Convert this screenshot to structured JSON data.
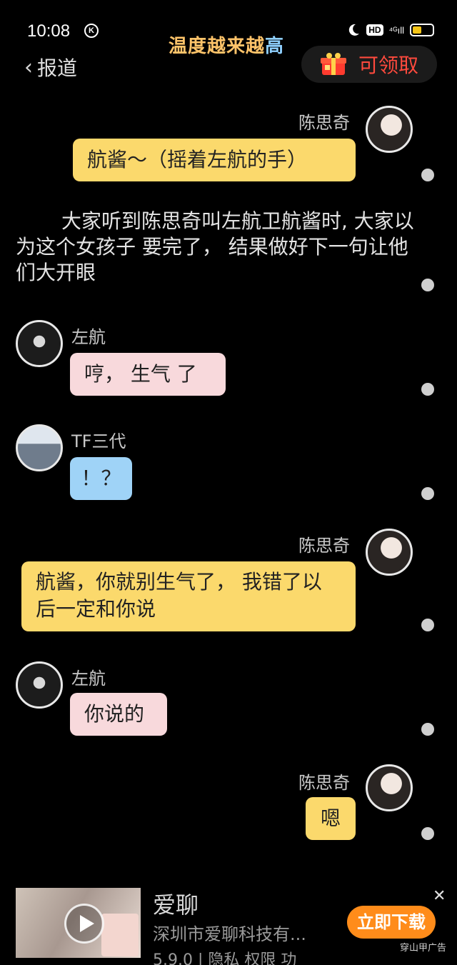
{
  "status_bar": {
    "time": "10:08",
    "k_badge": "K",
    "hd_badge": "HD",
    "signal": "⁴ᴳıll"
  },
  "banner": {
    "part1": "温度越来越",
    "part2": "高",
    "color1": "#ffc46a",
    "color2": "#8fd0ff"
  },
  "nav": {
    "back_label": "报道",
    "reward_label": "可领取"
  },
  "messages": [
    {
      "speaker": "陈思奇",
      "text": "航酱～（摇着左航的手）",
      "side": "right",
      "color": "yellow"
    },
    {
      "narration": "大家听到陈思奇叫左航卫航酱时, 大家以为这个女孩子 要完了，  结果做好下一句让他们大开眼"
    },
    {
      "speaker": "左航",
      "text": "哼，  生气  了",
      "side": "left",
      "color": "pink"
    },
    {
      "speaker": "TF三代",
      "text": "！？",
      "side": "left",
      "color": "blue"
    },
    {
      "speaker": "陈思奇",
      "text": "航酱，你就别生气了，  我错了以后一定和你说",
      "side": "right",
      "color": "yellow"
    },
    {
      "speaker": "左航",
      "text": "你说的",
      "side": "left",
      "color": "pink"
    },
    {
      "speaker": "陈思奇",
      "text": "嗯",
      "side": "right",
      "color": "yellow"
    }
  ],
  "ad": {
    "title": "爱聊",
    "company": "深圳市爱聊科技有...",
    "meta": "5.9.0 | 隐私  权限  功",
    "button": "立即下载",
    "source": "穿山甲广告",
    "close": "✕"
  }
}
